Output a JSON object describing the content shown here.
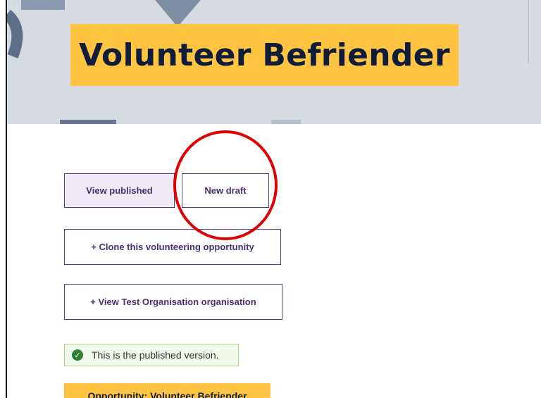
{
  "page": {
    "title": "Volunteer Befriender"
  },
  "actions": {
    "view_published": "View published",
    "new_draft": "New draft",
    "clone": "+ Clone this volunteering opportunity",
    "view_org": "+ View Test Organisation organisation"
  },
  "notice": {
    "text": "This is the published version.",
    "icon": "check-circle-icon"
  },
  "opportunity_tab": {
    "label": "Opportunity: Volunteer Befriender"
  },
  "annotation": {
    "shape": "circle",
    "color": "#e00000"
  },
  "colors": {
    "brand_yellow": "#ffc542",
    "title_navy": "#0f1d3a",
    "button_purple": "#5a3d86",
    "hero_bg": "#d6dbe1"
  }
}
